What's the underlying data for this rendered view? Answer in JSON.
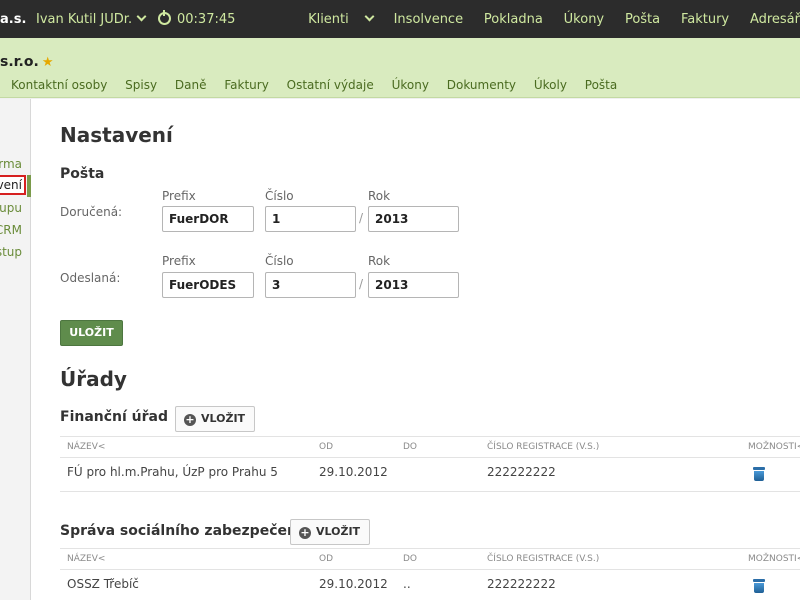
{
  "topbar": {
    "brand": "a.s.",
    "user": "Ivan Kutil JUDr.",
    "timer": "00:37:45",
    "nav": [
      "Klienti",
      "Insolvence",
      "Pokladna",
      "Úkony",
      "Pošta",
      "Faktury",
      "Adresář"
    ]
  },
  "client": {
    "company": "s.r.o.",
    "tabs": [
      "Kontaktní osoby",
      "Spisy",
      "Daně",
      "Faktury",
      "Ostatní výdaje",
      "Úkony",
      "Dokumenty",
      "Úkoly",
      "Pošta"
    ]
  },
  "sidebar": {
    "items": [
      "rma",
      "vení",
      "tupu",
      "CRM",
      "stup"
    ]
  },
  "settings": {
    "title": "Nastavení",
    "posta_title": "Pošta",
    "prefix_label": "Prefix",
    "number_label": "Číslo",
    "year_label": "Rok",
    "slash": "/",
    "received": {
      "label": "Doručená:",
      "prefix": "FuerDOR",
      "number": "1",
      "year": "2013"
    },
    "sent": {
      "label": "Odeslaná:",
      "prefix": "FuerODES",
      "number": "3",
      "year": "2013"
    },
    "save_label": "ULOŽIT"
  },
  "offices": {
    "title": "Úřady",
    "add_label": "VLOŽIT",
    "columns": [
      "NÁZEV<",
      "OD",
      "DO",
      "ČÍSLO REGISTRACE (V.S.)",
      "MOŽNOSTI<"
    ],
    "sections": [
      {
        "title": "Finanční úřad",
        "row": {
          "name": "FÚ pro hl.m.Prahu, ÚzP pro Prahu 5",
          "from": "29.10.2012",
          "to": "",
          "reg": "222222222"
        }
      },
      {
        "title": "Správa sociálního zabezpečení",
        "row": {
          "name": "OSSZ Třebíč",
          "from": "29.10.2012",
          "to": "..",
          "reg": "222222222"
        }
      }
    ]
  },
  "colors": {
    "topbar": "#2c2c2c",
    "subheader": "#d9ebbf",
    "accent_green": "#5f8c4c",
    "active_outline": "#d62020"
  },
  "icons": {
    "timer": "clock-icon",
    "dropdown": "chevron-down-icon",
    "favorite": "star-icon",
    "add": "plus-circle-icon",
    "delete": "trash-icon"
  }
}
